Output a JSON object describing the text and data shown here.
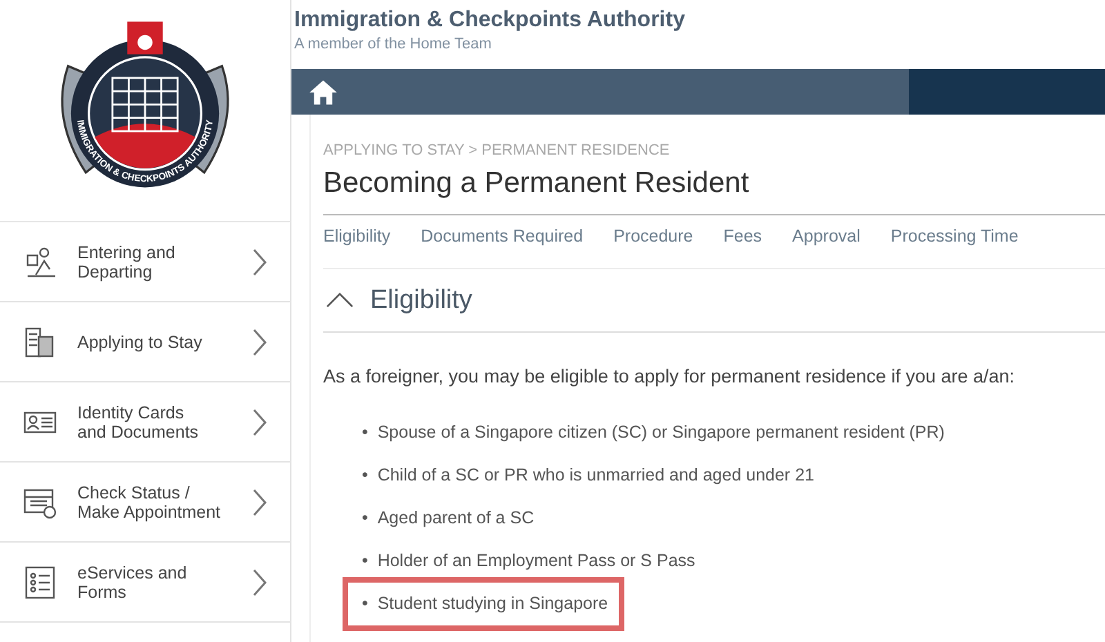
{
  "logo": {
    "ring_text": "IMMIGRATION & CHECKPOINTS AUTHORITY"
  },
  "header": {
    "title": "Immigration & Checkpoints Authority",
    "subtitle": "A member of the Home Team"
  },
  "sidebar": {
    "items": [
      {
        "label": "Entering and\nDeparting"
      },
      {
        "label": "Applying to Stay"
      },
      {
        "label": "Identity Cards\nand Documents"
      },
      {
        "label": "Check Status /\nMake Appointment"
      },
      {
        "label": "eServices and\nForms"
      }
    ]
  },
  "breadcrumb": "APPLYING TO STAY > PERMANENT RESIDENCE",
  "page_title": "Becoming a Permanent Resident",
  "tabs": [
    {
      "label": "Eligibility",
      "selected": false
    },
    {
      "label": "Documents Required",
      "selected": false
    },
    {
      "label": "Procedure",
      "selected": false
    },
    {
      "label": "Fees",
      "selected": false
    },
    {
      "label": "Approval",
      "selected": false
    },
    {
      "label": "Processing Time",
      "selected": false
    }
  ],
  "section": {
    "title": "Eligibility",
    "expanded": true,
    "intro": "As a foreigner, you may be eligible to apply for permanent residence if you are a/an:",
    "bullets": [
      {
        "marker": "•",
        "text": "Spouse of a Singapore citizen (SC) or Singapore permanent resident (PR)",
        "highlighted": false
      },
      {
        "marker": "•",
        "text": "Child of a SC or PR who is unmarried and aged under 21",
        "highlighted": false
      },
      {
        "marker": "•",
        "text": "Aged parent of a SC",
        "highlighted": false
      },
      {
        "marker": "•",
        "text": "Holder of an Employment Pass or S Pass",
        "highlighted": false
      },
      {
        "marker": "•",
        "text": "Student studying in Singapore",
        "highlighted": true
      }
    ]
  }
}
